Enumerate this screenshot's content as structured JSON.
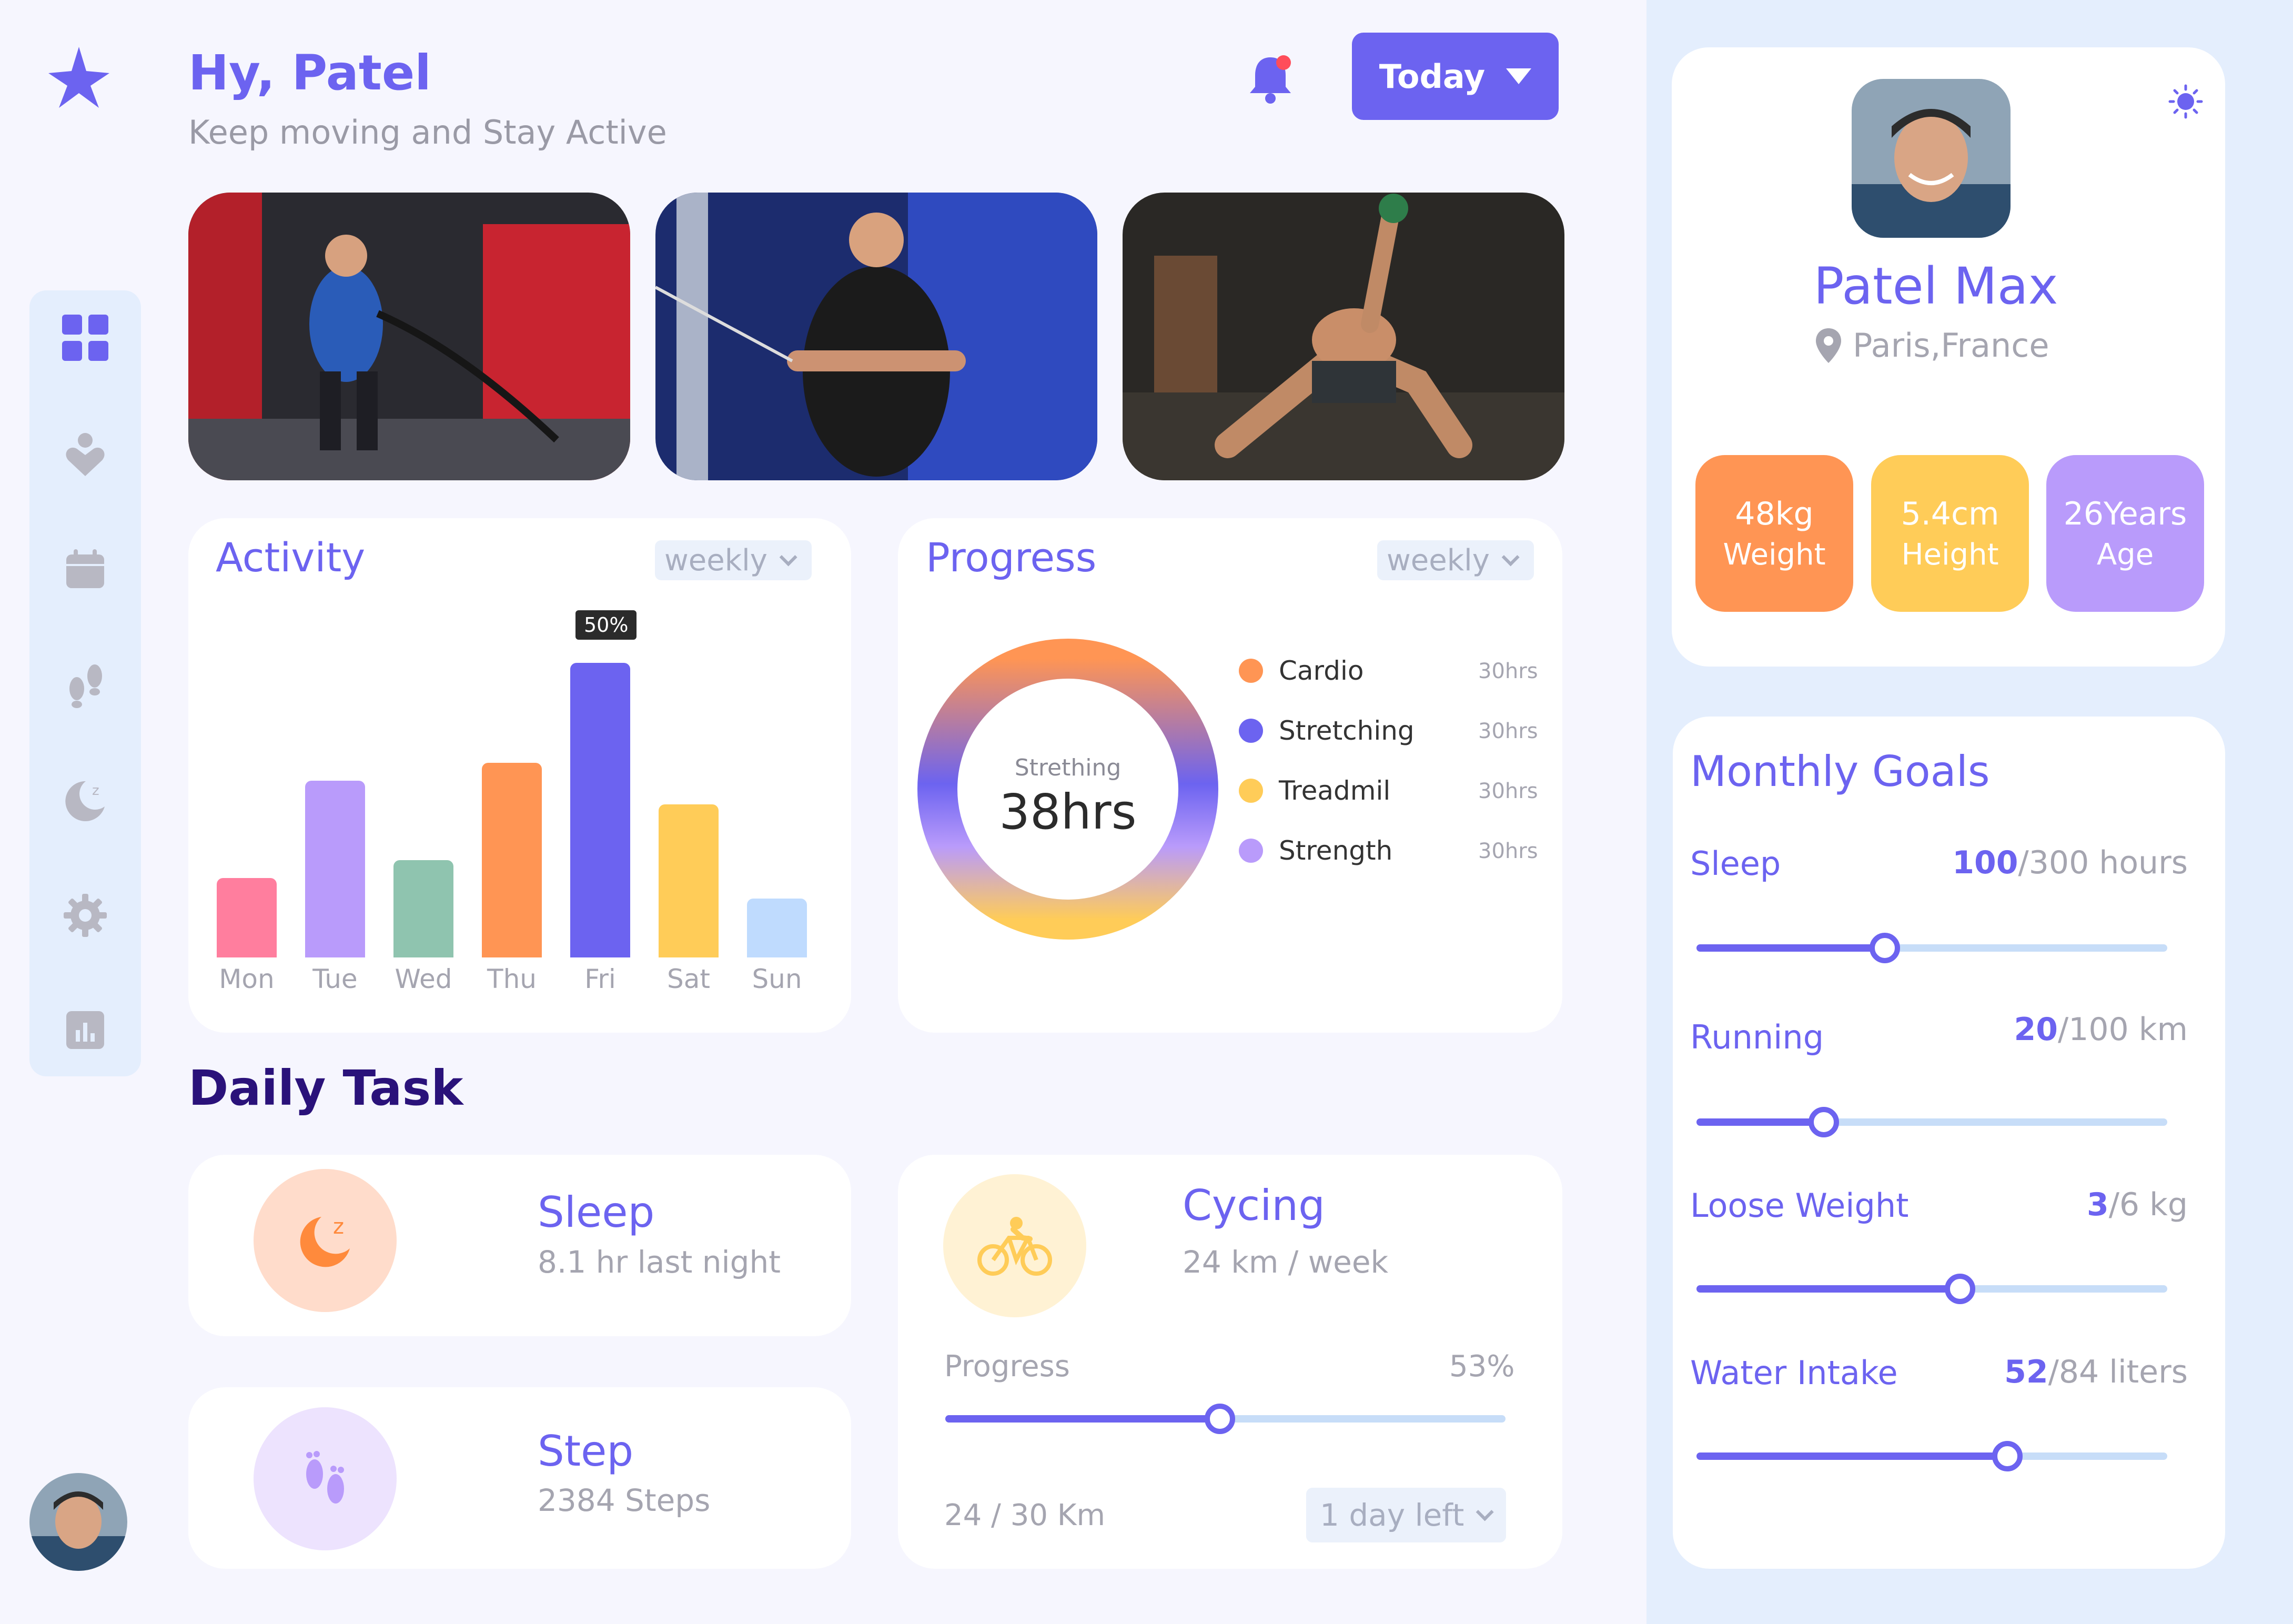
{
  "header": {
    "greeting": "Hy, Patel",
    "subtitle": "Keep moving and Stay Active",
    "period_button": "Today"
  },
  "sidebar": {
    "items": [
      {
        "icon": "grid-icon",
        "active": true
      },
      {
        "icon": "heart-icon",
        "active": false
      },
      {
        "icon": "calendar-icon",
        "active": false
      },
      {
        "icon": "footprints-icon",
        "active": false
      },
      {
        "icon": "moon-icon",
        "active": false
      },
      {
        "icon": "gear-icon",
        "active": false
      },
      {
        "icon": "bar-chart-icon",
        "active": false
      }
    ]
  },
  "activity": {
    "title": "Activity",
    "filter": "weekly",
    "highlight_label": "50%"
  },
  "chart_data": {
    "type": "bar",
    "categories": [
      "Mon",
      "Tue",
      "Wed",
      "Thu",
      "Fri",
      "Sat",
      "Sun"
    ],
    "values": [
      27,
      60,
      33,
      66,
      100,
      52,
      20
    ],
    "colors": [
      "#FF7E9E",
      "#B99BFB",
      "#8FC4AF",
      "#FF9554",
      "#6C63F0",
      "#FFCC58",
      "#BFDBFE"
    ],
    "ylim": [
      0,
      100
    ]
  },
  "progress": {
    "title": "Progress",
    "filter": "weekly",
    "center_label": "Strething",
    "center_value": "38hrs",
    "legend": [
      {
        "name": "Cardio",
        "value": "30hrs",
        "color": "#FF9554"
      },
      {
        "name": "Stretching",
        "value": "30hrs",
        "color": "#6C63F0"
      },
      {
        "name": "Treadmil",
        "value": "30hrs",
        "color": "#FFCC58"
      },
      {
        "name": "Strength",
        "value": "30hrs",
        "color": "#B99BFB"
      }
    ]
  },
  "daily_task": {
    "title": "Daily Task",
    "sleep": {
      "name": "Sleep",
      "detail": "8.1 hr last night"
    },
    "step": {
      "name": "Step",
      "detail": "2384 Steps"
    },
    "cycling": {
      "name": "Cycing",
      "detail": "24 km / week",
      "progress_label": "Progress",
      "progress_value": "53%",
      "progress_fraction": 0.49,
      "distance": "24  / 30 Km",
      "deadline": "1 day left"
    }
  },
  "profile": {
    "name": "Patel Max",
    "location": "Paris,France",
    "stats": [
      {
        "value": "48kg",
        "label": "Weight",
        "color": "#FF9554"
      },
      {
        "value": "5.4cm",
        "label": "Height",
        "color": "#FFCC58"
      },
      {
        "value": "26Years",
        "label": "Age",
        "color": "#B99BFB"
      }
    ]
  },
  "monthly_goals": {
    "title": "Monthly Goals",
    "goals": [
      {
        "name": "Sleep",
        "current": "100",
        "target": "/300 hours",
        "fraction": 0.4
      },
      {
        "name": "Running",
        "current": "20",
        "target": "/100 km",
        "fraction": 0.27
      },
      {
        "name": "Loose Weight",
        "current": "3",
        "target": "/6 kg",
        "fraction": 0.56
      },
      {
        "name": "Water Intake",
        "current": "52",
        "target": "/84 liters",
        "fraction": 0.66
      }
    ]
  }
}
